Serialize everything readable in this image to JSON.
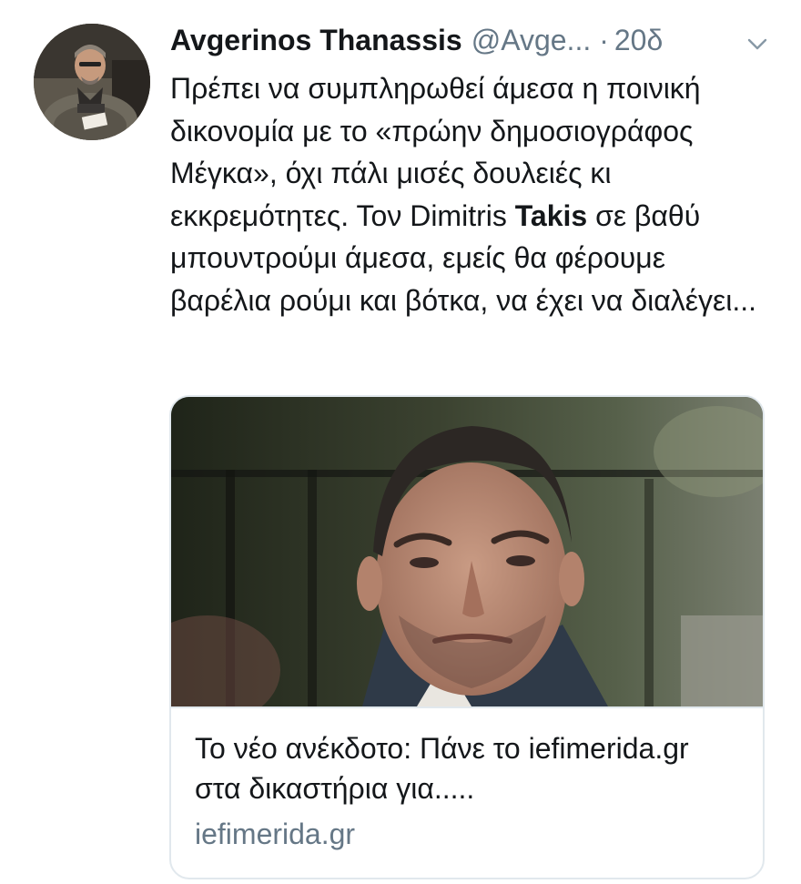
{
  "tweet": {
    "author_name": "Avgerinos Thanassis",
    "author_handle": "@Avge...",
    "separator": "·",
    "timestamp": "20δ",
    "menu_icon": "chevron-down-icon",
    "avatar_icon": "avatar-photo",
    "text_part1": "Πρέπει να συμπληρωθεί άμεσα η ποινική δικονομία με το «πρώην δημοσιογράφος Μέγκα», όχι πάλι μισές δουλειές κι εκκρεμότητες. Τον Dimitris ",
    "text_bold": "Takis",
    "text_part2": " σε βαθύ μπουντρούμι άμεσα, εμείς θα φέρουμε βαρέλια ρούμι και βότκα, να έχει να διαλέγει..."
  },
  "card": {
    "image_icon": "link-preview-photo",
    "title": "Το νέο ανέκδοτο: Πάνε το iefimerida.gr στα δικαστήρια για.....",
    "domain": "iefimerida.gr"
  },
  "colors": {
    "text_primary": "#14171a",
    "text_secondary": "#657786",
    "border": "#e1e8ed",
    "background": "#ffffff"
  }
}
